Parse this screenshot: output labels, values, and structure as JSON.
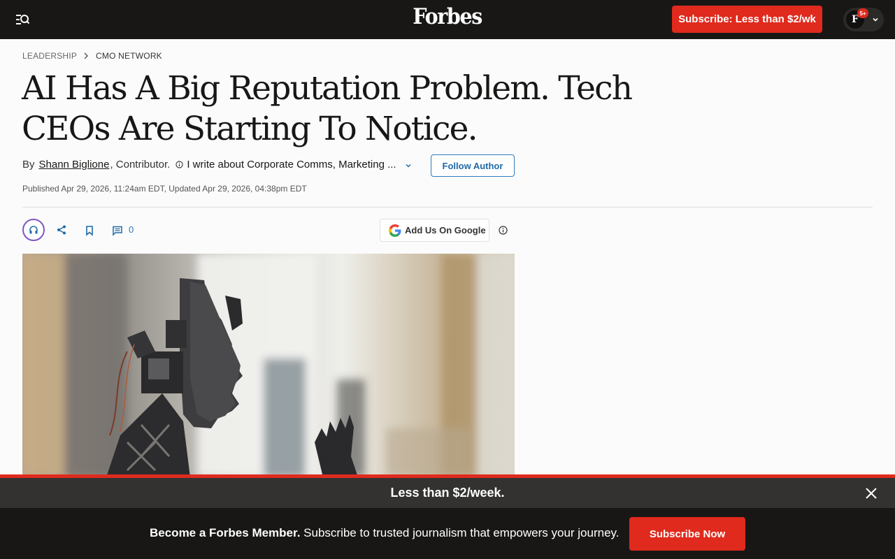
{
  "header": {
    "logo": "Forbes",
    "subscribe_label": "Subscribe: Less than $2/wk",
    "account_initial": "F",
    "notification_count": "5+"
  },
  "breadcrumb": {
    "section": "LEADERSHIP",
    "subsection": "CMO NETWORK"
  },
  "article": {
    "headline": "AI Has A Big Reputation Problem. Tech CEOs Are Starting To Notice.",
    "by_label": "By",
    "author": "Shann Biglione",
    "author_role": ", Contributor.",
    "author_bio": "I write about Corporate Comms, Marketing ...",
    "follow_label": "Follow Author",
    "published": "Published Apr 29, 2026, 11:24am EDT, Updated Apr 29, 2026, 04:38pm EDT",
    "comment_count": "0",
    "google_label": "Add Us On Google"
  },
  "banner": {
    "headline": "Less than $2/week.",
    "member_bold": "Become a Forbes Member.",
    "member_text": "Subscribe to trusted journalism that empowers your journey.",
    "cta_label": "Subscribe Now"
  },
  "icons": {
    "menu": "menu-search-icon",
    "chevron": "chevron-down-icon",
    "listen": "headphones-icon",
    "share": "share-icon",
    "bookmark": "bookmark-icon",
    "comment": "comment-icon",
    "google": "google-icon",
    "info": "info-icon",
    "close": "close-icon"
  },
  "colors": {
    "brand_red": "#e02a1d",
    "link_blue": "#2f7ab8",
    "header_bg": "#181716"
  }
}
